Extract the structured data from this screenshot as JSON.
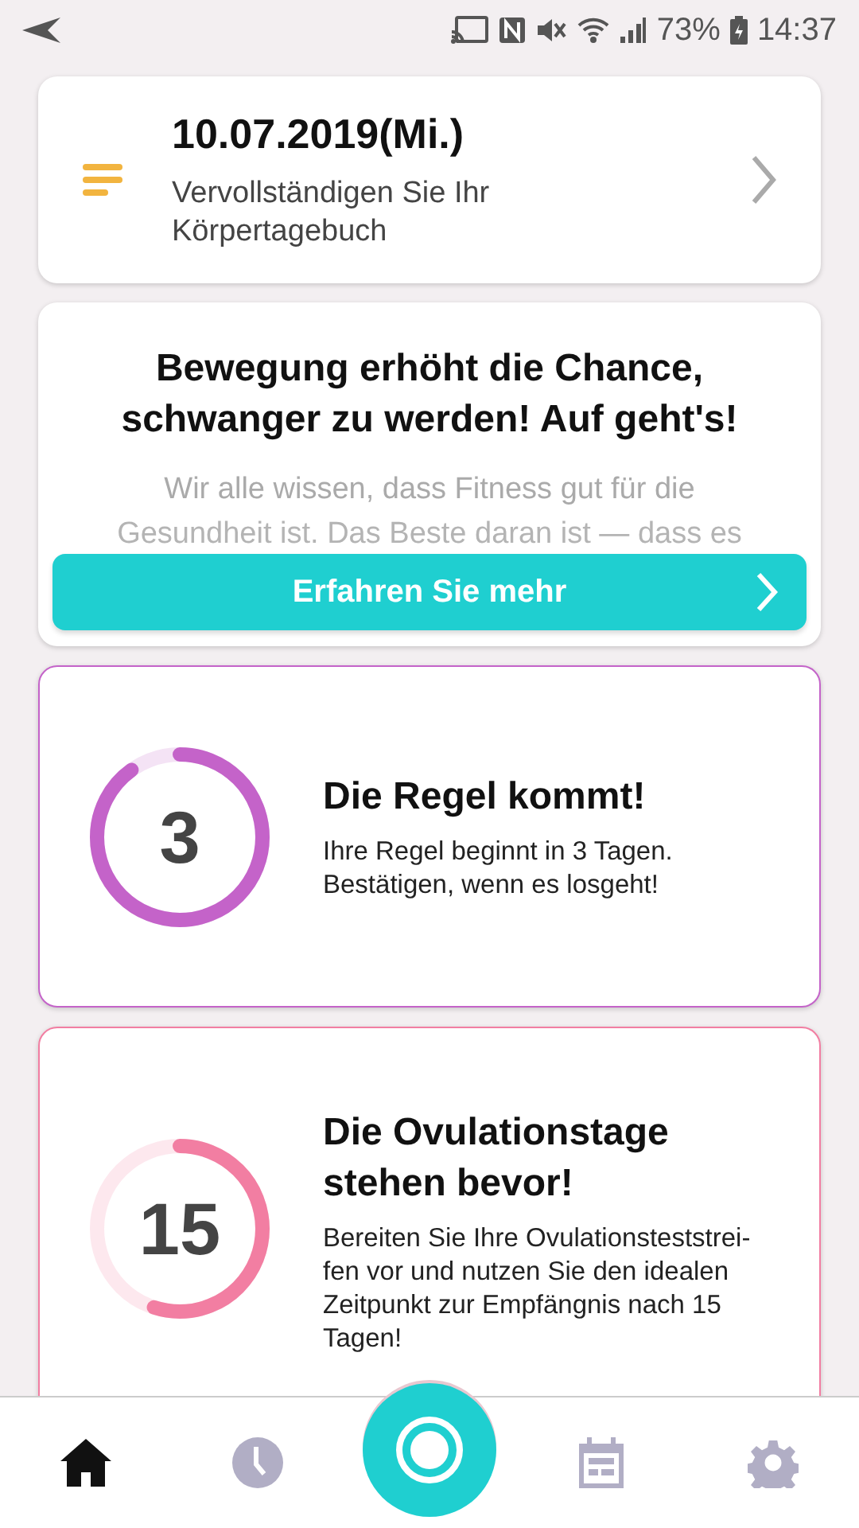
{
  "status_bar": {
    "battery": "73%",
    "time": "14:37"
  },
  "diary_card": {
    "date": "10.07.2019(Mi.)",
    "text_lines": [
      "Vervollständigen Sie Ihr",
      "Körpertagebuch"
    ]
  },
  "article_card": {
    "title": "Bewegung erhöht die Chance, schwanger zu werden! Auf geht's!",
    "body_lines": [
      "Wir alle wissen, dass Fitness gut für die",
      "Gesundheit ist. Das Beste daran ist — dass es"
    ],
    "button": "Erfahren Sie mehr"
  },
  "cycle_cards": [
    {
      "number": "3",
      "title": "Die Regel kommt!",
      "text_lines": [
        "Ihre Regel beginnt in 3 Tagen.",
        "Bestätigen, wenn es losgeht!"
      ],
      "level": 0.9,
      "color": "#c463c9"
    },
    {
      "number": "15",
      "title": "Die Ovulationstage stehen bevor!",
      "text_lines": [
        "Bereiten Sie Ihre Ovulationsteststrei-",
        "fen vor und nutzen Sie den idealen",
        "Zeitpunkt zur Empfängnis nach 15",
        "Tagen!"
      ],
      "level": 0.55,
      "color": "#f27ea2"
    }
  ],
  "nav": [
    {
      "kind": "home",
      "selected": true
    },
    {
      "kind": "clock",
      "selected": false
    },
    {
      "kind": "record",
      "selected": false
    },
    {
      "kind": "calendar",
      "selected": false
    },
    {
      "kind": "settings",
      "selected": false
    }
  ]
}
